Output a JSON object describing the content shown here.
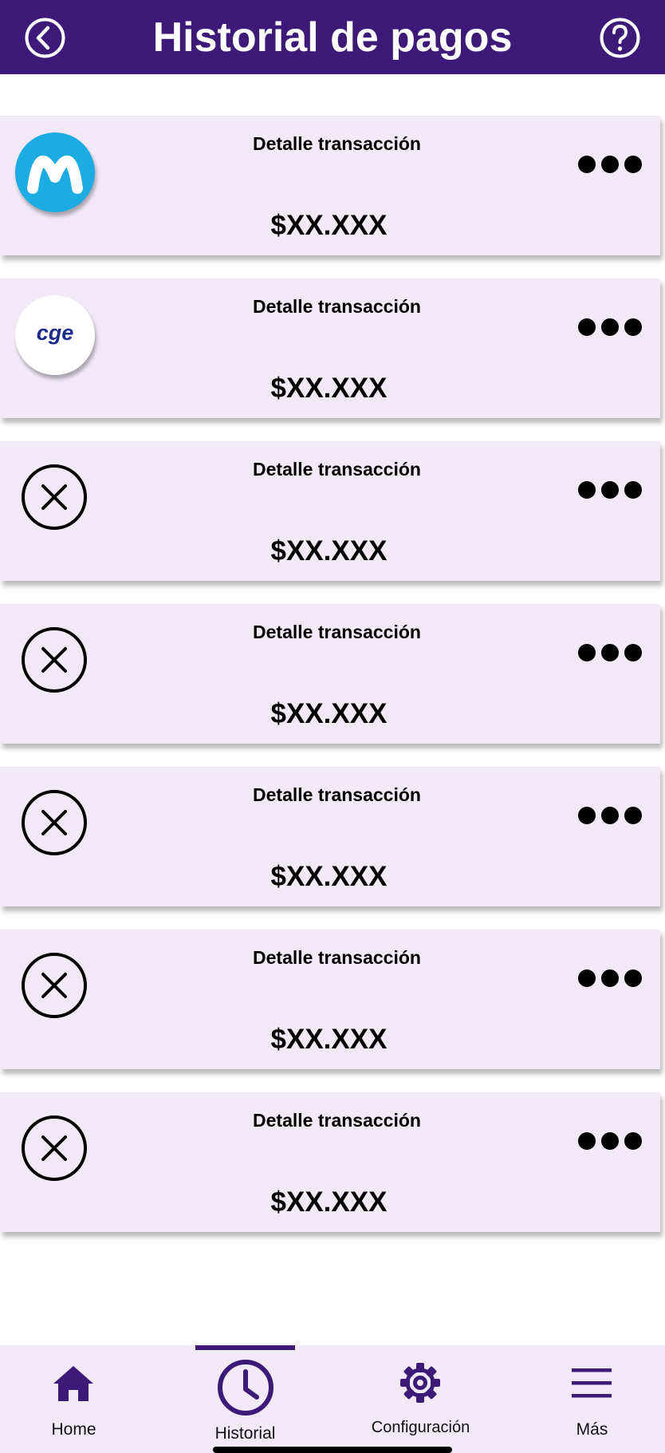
{
  "header": {
    "title": "Historial de pagos",
    "back_icon": "chevron-left-circle-icon",
    "help_icon": "question-circle-icon",
    "background": "#3d1a78"
  },
  "transactions": [
    {
      "logo": "movistar-logo",
      "detail_label": "Detalle transacción",
      "amount": "$XX.XXX"
    },
    {
      "logo": "cge-logo",
      "logo_text": "cge",
      "detail_label": "Detalle transacción",
      "amount": "$XX.XXX"
    },
    {
      "logo": "cancel-icon",
      "detail_label": "Detalle transacción",
      "amount": "$XX.XXX"
    },
    {
      "logo": "cancel-icon",
      "detail_label": "Detalle transacción",
      "amount": "$XX.XXX"
    },
    {
      "logo": "cancel-icon",
      "detail_label": "Detalle transacción",
      "amount": "$XX.XXX"
    },
    {
      "logo": "cancel-icon",
      "detail_label": "Detalle transacción",
      "amount": "$XX.XXX"
    },
    {
      "logo": "cancel-icon",
      "detail_label": "Detalle transacción",
      "amount": "$XX.XXX"
    }
  ],
  "card_background": "#f1e9f6",
  "tabbar": {
    "active": "Historial",
    "items": [
      {
        "label": "Home",
        "icon": "home-icon"
      },
      {
        "label": "Historial",
        "icon": "clock-icon"
      },
      {
        "label": "Configuración",
        "icon": "gear-icon"
      },
      {
        "label": "Más",
        "icon": "menu-icon"
      }
    ]
  },
  "accent": "#3d1a78",
  "movistar_blue": "#1cabe2",
  "cge_blue": "#1b2a8c"
}
